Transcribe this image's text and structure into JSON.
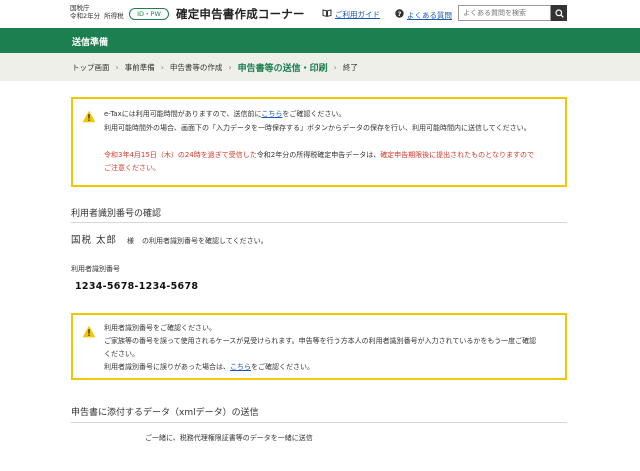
{
  "header": {
    "agency_name": "国税庁",
    "year": "令和2年分",
    "tax_type": "所得税",
    "login_badge": "ID・PW",
    "app_title": "確定申告書作成コーナー",
    "guide_link": "ご利用ガイド",
    "faq_link": "よくある質問",
    "search_placeholder": "よくある質問を検索"
  },
  "band": {
    "title": "送信準備"
  },
  "breadcrumb": {
    "items": [
      "トップ画面",
      "事前準備",
      "申告書等の作成",
      "申告書等の送信・印刷",
      "終了"
    ],
    "current_index": 3
  },
  "notice1": {
    "line1_pre": "e-Taxには利用可能時間がありますので、送信前に",
    "line1_link": "こちら",
    "line1_post": "をご確認ください。",
    "line2": "利用可能時間外の場合、画面下の「入力データを一時保存する」ボタンからデータの保存を行い、利用可能時間内に送信してください。",
    "line3_red1": "令和3年4月15日（木）の24時を過ぎて受信した",
    "line3_black": "令和2年分の所得税確定申告データは、",
    "line3_red2": "確定申告期限後に提出されたものとなりますので",
    "line4_red": "ご注意ください。"
  },
  "user_section": {
    "heading": "利用者識別番号の確認",
    "name": "国税 太郎",
    "sama": "様",
    "message": "の利用者識別番号を確認してください。",
    "id_label": "利用者識別番号",
    "id_value": "1234-5678-1234-5678"
  },
  "notice2": {
    "line1": "利用者識別番号をご確認ください。",
    "line2": "ご家族等の番号を誤って使用されるケースが見受けられます。申告等を行う方本人の利用者識別番号が入力されているかをもう一度ご確認",
    "line3": "ください。",
    "line4_pre": "利用者識別番号に誤りがあった場合は、",
    "line4_link": "こちら",
    "line4_post": "をご確認ください。"
  },
  "xml_section": {
    "heading": "申告書に添付するデータ（xmlデータ）の送信",
    "partial_line": "ご一緒に、税務代理権限証書等のデータを一緒に送信"
  },
  "colors": {
    "brand_green": "#1b7f4f",
    "notice_border": "#f0c800",
    "warning_red": "#d03a2a",
    "link_blue": "#1a56b5"
  }
}
